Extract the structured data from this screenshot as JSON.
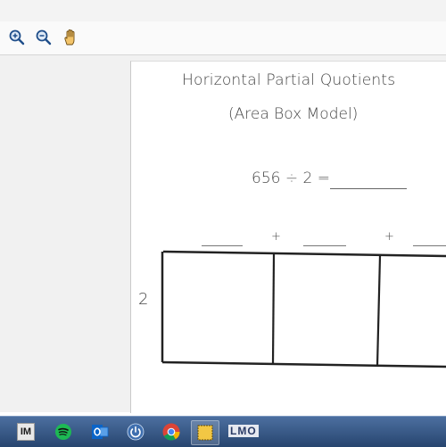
{
  "toolbar": {
    "zoom_in_icon": "zoom-in-icon",
    "zoom_out_icon": "zoom-out-icon",
    "hand_tool_icon": "hand-icon"
  },
  "worksheet": {
    "title": "Horizontal Partial Quotients",
    "subtitle": "(Area Box Model)",
    "equation": "656 ÷ 2 =",
    "plus_sign": "+",
    "divisor": "2"
  },
  "taskbar": {
    "im_label": "IM",
    "lmo_label": "LMO",
    "icons": [
      "im-icon",
      "spotify-icon",
      "outlook-icon",
      "power-icon",
      "chrome-icon",
      "sticky-notes-icon",
      "lmo-icon"
    ]
  },
  "colors": {
    "taskbar": "#2f5180",
    "ink": "#444444",
    "box_lines": "#222222"
  }
}
